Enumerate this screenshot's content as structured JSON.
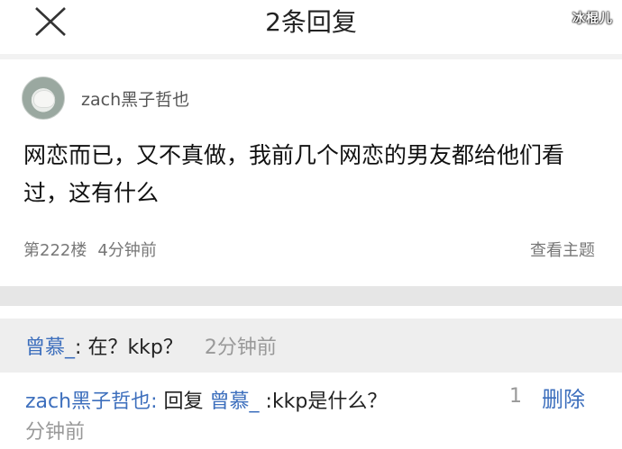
{
  "header": {
    "title": "2条回复",
    "close_icon": "close-icon",
    "watermark": "冰棍儿"
  },
  "post": {
    "author": "zach黑子哲也",
    "text": "网恋而已，又不真做，我前几个网恋的男友都给他们看过，这有什么",
    "floor": "第222楼",
    "time": "4分钟前",
    "view_topic_label": "查看主题"
  },
  "replies": [
    {
      "author": "曾慕_",
      "separator": ":",
      "text": "在？kkp？",
      "time": "2分钟前"
    },
    {
      "author": "zach黑子哲也",
      "separator": ":",
      "reply_word": "回复",
      "reply_to": "曾慕_",
      "text": ":kkp是什么？",
      "time_part1": "1",
      "time_part2": "分钟前",
      "delete_label": "删除"
    }
  ],
  "colors": {
    "link_blue": "#3d6fbd",
    "meta_grey": "#777777",
    "divider": "#e6e6e6"
  }
}
